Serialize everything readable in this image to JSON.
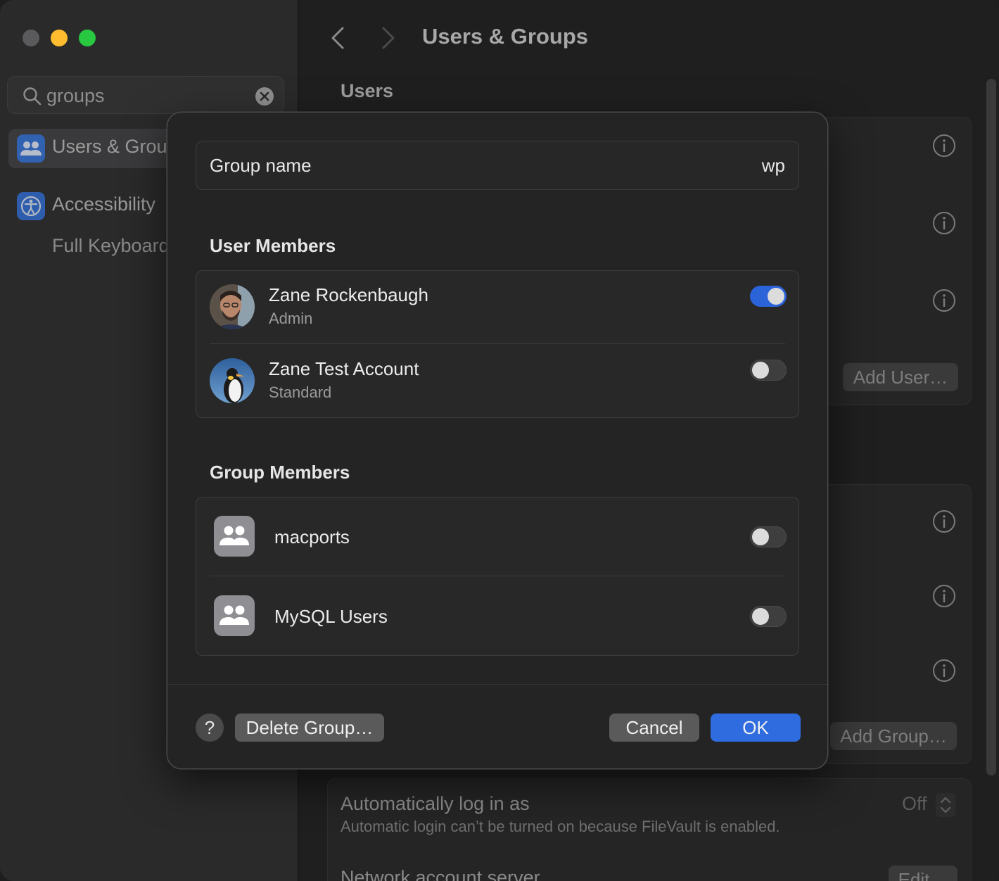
{
  "colors": {
    "accent": "#2e6ce0",
    "toggle_on": "#2b63d9",
    "traffic_close": "#5a5a5c",
    "traffic_minimize": "#febc2e",
    "traffic_maximize": "#28c840"
  },
  "sidebar": {
    "search": {
      "value": "groups",
      "icon": "search-icon",
      "clear_icon": "clear-icon"
    },
    "items": [
      {
        "label": "Users & Grou",
        "icon": "users-groups-icon",
        "selected": true
      },
      {
        "label": "Accessibility",
        "icon": "accessibility-icon",
        "selected": false
      }
    ],
    "sub_items": [
      {
        "label": "Full Keyboard"
      }
    ]
  },
  "header": {
    "title": "Users & Groups",
    "back_icon": "chevron-left-icon",
    "forward_icon": "chevron-right-icon"
  },
  "main": {
    "users_section_title": "Users",
    "add_user_label": "Add User…",
    "add_group_label": "Add Group…",
    "auto_login": {
      "title": "Automatically log in as",
      "value": "Off",
      "description": "Automatic login can’t be turned on because FileVault is enabled."
    },
    "network_account": {
      "title": "Network account server",
      "edit_label": "Edit…"
    }
  },
  "sheet": {
    "group_name_label": "Group name",
    "group_name_value": "wp",
    "user_members_heading": "User Members",
    "user_members": [
      {
        "name": "Zane Rockenbaugh",
        "role": "Admin",
        "enabled": true
      },
      {
        "name": "Zane Test Account",
        "role": "Standard",
        "enabled": false
      }
    ],
    "group_members_heading": "Group Members",
    "group_members": [
      {
        "name": "macports",
        "enabled": false
      },
      {
        "name": "MySQL Users",
        "enabled": false
      }
    ],
    "help_label": "?",
    "delete_label": "Delete Group…",
    "cancel_label": "Cancel",
    "ok_label": "OK"
  }
}
